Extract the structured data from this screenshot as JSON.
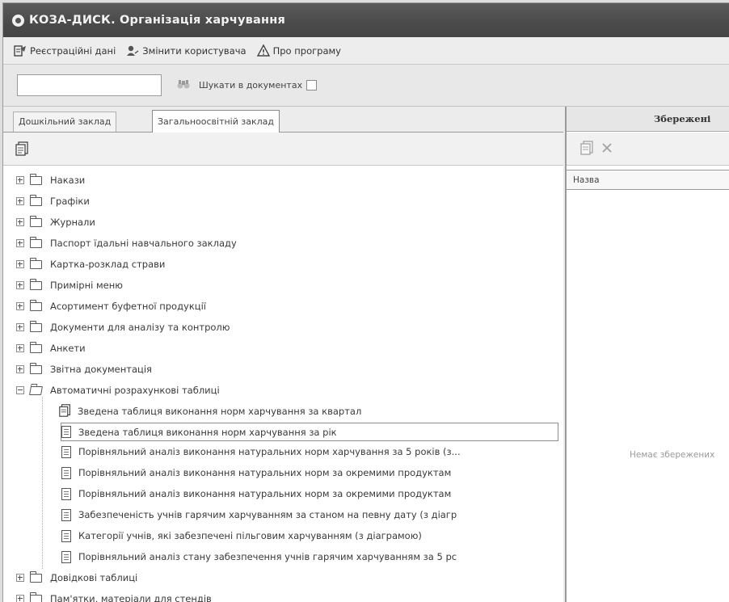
{
  "window": {
    "title": "КОЗА-ДИСК. Організація харчування"
  },
  "menu": [
    {
      "label": "Реєстраційні дані",
      "icon": "registration-icon"
    },
    {
      "label": "Змінити користувача",
      "icon": "change-user-icon"
    },
    {
      "label": "Про програму",
      "icon": "about-icon"
    }
  ],
  "search": {
    "value": "",
    "checkbox_label": "Шукати в документах",
    "checked": false
  },
  "tabs": [
    {
      "label": "Дошкільний заклад",
      "active": false
    },
    {
      "label": "Загальноосвітній заклад",
      "active": true
    }
  ],
  "tree": {
    "folders_top": [
      "Накази",
      "Графіки",
      "Журнали",
      "Паспорт їдальні навчального закладу",
      "Картка-розклад страви",
      "Примірні меню",
      "Асортимент буфетної продукції",
      "Документи для аналізу та контролю",
      "Анкети",
      "Звітна документація"
    ],
    "expanded_folder": "Автоматичні розрахункові таблиці",
    "children": [
      "Зведена таблиця виконання норм харчування за квартал",
      "Зведена таблиця виконання норм харчування за рік",
      "Порівняльний аналіз виконання натуральних норм харчування за 5 років (з...",
      "Порівняльний аналіз виконання натуральних норм за окремими продуктам",
      "Порівняльний аналіз виконання натуральних норм за окремими продуктам",
      "Забезпеченість учнів гарячим харчуванням за станом на певну дату (з діагр",
      "Категорії учнів, які забезпечені пільговим харчуванням (з діаграмою)",
      "Порівняльний аналіз стану забезпечення учнів гарячим харчуванням за 5 рс"
    ],
    "selected_child_index": 1,
    "folders_bottom": [
      "Довідкові таблиці",
      "Пам'ятки, матеріали для стендів"
    ]
  },
  "right_panel": {
    "header": "Збережені",
    "column_header": "Назва",
    "empty_text": "Немає збережених"
  }
}
